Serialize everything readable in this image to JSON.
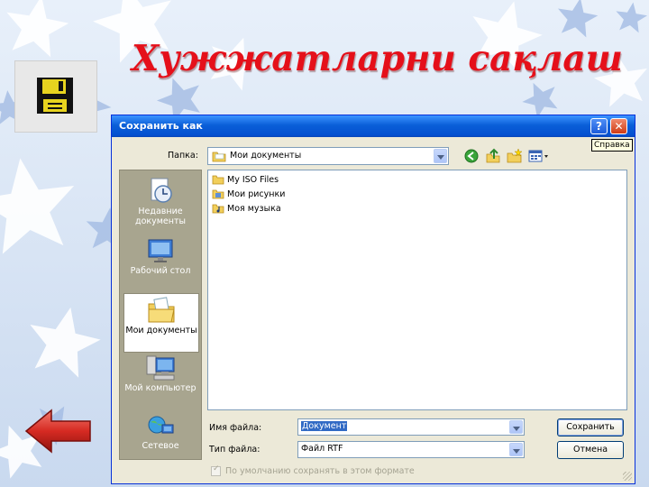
{
  "slide": {
    "title": "Хужжатларни сақлаш"
  },
  "dialog": {
    "title": "Сохранить как",
    "tooltip": "Справка",
    "folder_label": "Папка:",
    "folder_value": "Мои документы",
    "places": [
      {
        "label": "Недавние документы",
        "icon": "recent-documents-icon"
      },
      {
        "label": "Рабочий стол",
        "icon": "desktop-icon"
      },
      {
        "label": "Мои документы",
        "icon": "my-documents-icon"
      },
      {
        "label": "Мой компьютер",
        "icon": "my-computer-icon"
      },
      {
        "label": "Сетевое",
        "icon": "network-icon"
      }
    ],
    "files": [
      {
        "name": "My ISO Files",
        "icon": "folder-icon"
      },
      {
        "name": "Мои рисунки",
        "icon": "pictures-folder-icon"
      },
      {
        "name": "Моя музыка",
        "icon": "music-folder-icon"
      }
    ],
    "filename_label": "Имя файла:",
    "filename_value": "Документ",
    "filetype_label": "Тип файла:",
    "filetype_value": "Файл RTF",
    "save_label": "Сохранить",
    "cancel_label": "Отмена",
    "default_format_label": "По умолчанию сохранять в этом формате",
    "default_format_checked": true
  },
  "colors": {
    "title_red": "#e5101a",
    "titlebar_blue": "#0a5fd8",
    "dialog_face": "#ece9d8"
  }
}
